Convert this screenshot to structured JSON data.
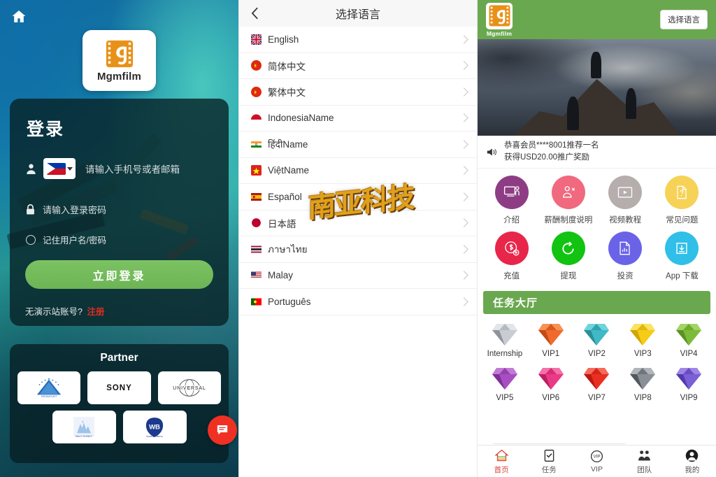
{
  "login": {
    "home_icon": "home-icon",
    "brand": "Mgmfilm",
    "title": "登录",
    "phone_placeholder": "请输入手机号或者邮箱",
    "country_flag": "philippines-flag",
    "password_placeholder": "请输入登录密码",
    "remember_label": "记住用户名/密码",
    "submit_label": "立即登录",
    "register_prompt": "无演示站账号?",
    "register_link": "注册",
    "partner_title": "Partner",
    "partners": [
      {
        "name": "Paramount",
        "text": ""
      },
      {
        "name": "SONY",
        "text": "SONY"
      },
      {
        "name": "Universal",
        "text": "UNIVERSAL"
      },
      {
        "name": "Walt Disney",
        "text": "WALT DISNEY"
      },
      {
        "name": "Warner Bros",
        "text": "WB"
      }
    ]
  },
  "language_panel": {
    "back_icon": "chevron-left-icon",
    "title": "选择语言",
    "watermark": "南亚科技",
    "items": [
      {
        "label": "English",
        "flag": "uk-flag",
        "flag_colors": [
          "#012169",
          "#ffffff",
          "#C8102E"
        ]
      },
      {
        "label": "简体中文",
        "flag": "china-flag",
        "flag_colors": [
          "#de2910",
          "#ffde00"
        ]
      },
      {
        "label": "繁体中文",
        "flag": "china-flag",
        "flag_colors": [
          "#de2910",
          "#ffde00"
        ]
      },
      {
        "label": "IndonesiaName",
        "flag": "indonesia-flag",
        "flag_colors": [
          "#ce1126",
          "#ffffff"
        ]
      },
      {
        "label": "हिंदीName",
        "flag": "india-flag",
        "flag_colors": [
          "#ff9933",
          "#ffffff",
          "#138808"
        ]
      },
      {
        "label": "ViệtName",
        "flag": "vietnam-flag",
        "flag_colors": [
          "#da251d",
          "#ffff00"
        ]
      },
      {
        "label": "Español",
        "flag": "spain-flag",
        "flag_colors": [
          "#AA151B",
          "#F1BF00"
        ]
      },
      {
        "label": "日本語",
        "flag": "japan-flag",
        "flag_colors": [
          "#ffffff",
          "#bc002d"
        ]
      },
      {
        "label": "ภาษาไทย",
        "flag": "thailand-flag",
        "flag_colors": [
          "#A51931",
          "#ffffff",
          "#2D2A4A"
        ]
      },
      {
        "label": "Malay",
        "flag": "usa-flag",
        "flag_colors": [
          "#B22234",
          "#ffffff",
          "#3C3B6E"
        ]
      },
      {
        "label": "Português",
        "flag": "portugal-flag",
        "flag_colors": [
          "#006600",
          "#FF0000"
        ]
      }
    ]
  },
  "app": {
    "brand": "Mgmfilm",
    "language_button": "选择语言",
    "announcement": "恭喜会员****8001推荐一名\n获得USD20.00推广奖励",
    "announcement_line1": "恭喜会员****8001推荐一名",
    "announcement_line2": "获得USD20.00推广奖励",
    "speaker_icon": "speaker-icon",
    "quick_actions": [
      {
        "label": "介绍",
        "icon": "presentation-icon",
        "color": "#8e3d84"
      },
      {
        "label": "薪酬制度说明",
        "icon": "salary-icon",
        "color": "#f0697f"
      },
      {
        "label": "视频教程",
        "icon": "video-icon",
        "color": "#b5aead"
      },
      {
        "label": "常见问题",
        "icon": "faq-icon",
        "color": "#f6d256"
      },
      {
        "label": "充值",
        "icon": "recharge-icon",
        "color": "#e8264a"
      },
      {
        "label": "提现",
        "icon": "withdraw-icon",
        "color": "#12c312"
      },
      {
        "label": "投资",
        "icon": "invest-icon",
        "color": "#6a63e8"
      },
      {
        "label": "App 下载",
        "icon": "download-icon",
        "color": "#30bfe8"
      }
    ],
    "task_hall_title": "任务大厅",
    "vip_levels": [
      {
        "label": "Internship",
        "color": "#c9ccd1",
        "dark": "#8e949c"
      },
      {
        "label": "VIP1",
        "color": "#ef6a2b",
        "dark": "#c34b14"
      },
      {
        "label": "VIP2",
        "color": "#3fb9c6",
        "dark": "#2a8e9c"
      },
      {
        "label": "VIP3",
        "color": "#f5cc17",
        "dark": "#d0a505"
      },
      {
        "label": "VIP4",
        "color": "#7dbb3a",
        "dark": "#5a9224"
      },
      {
        "label": "VIP5",
        "color": "#a74fc0",
        "dark": "#7f2e96"
      },
      {
        "label": "VIP6",
        "color": "#ea3a86",
        "dark": "#bd1e62"
      },
      {
        "label": "VIP7",
        "color": "#ea2f22",
        "dark": "#b81a10"
      },
      {
        "label": "VIP8",
        "color": "#8a8f96",
        "dark": "#53585f"
      },
      {
        "label": "VIP9",
        "color": "#7b5fd4",
        "dark": "#5639ac"
      }
    ],
    "bottom_nav": [
      {
        "label": "首页",
        "icon": "home-icon",
        "active": true
      },
      {
        "label": "任务",
        "icon": "task-icon",
        "active": false
      },
      {
        "label": "VIP",
        "icon": "vip-icon",
        "active": false
      },
      {
        "label": "团队",
        "icon": "team-icon",
        "active": false
      },
      {
        "label": "我的",
        "icon": "profile-icon",
        "active": false
      }
    ]
  },
  "chat_widget": {
    "icon": "chat-bubble-icon",
    "color": "#ef3124"
  }
}
